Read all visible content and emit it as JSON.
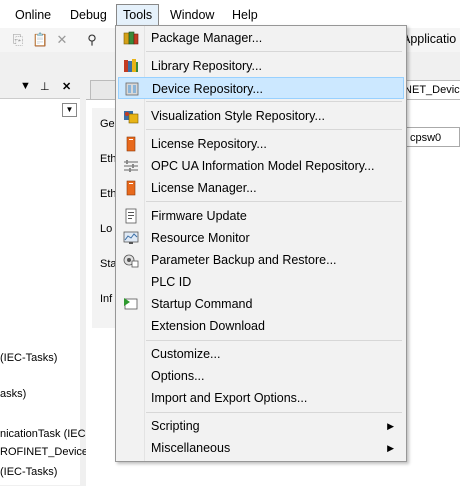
{
  "menubar": {
    "items": [
      {
        "label": "Online"
      },
      {
        "label": "Debug"
      },
      {
        "label": "Tools"
      },
      {
        "label": "Window"
      },
      {
        "label": "Help"
      }
    ]
  },
  "toolbar": {
    "right_text": "Applicatio"
  },
  "editor": {
    "tab2_label": "INET_Devic",
    "device_field_value": "cpsw0",
    "vertical_tabs": [
      "Ge",
      "Eth",
      "Eth",
      "Lo",
      "Sta",
      "Inf"
    ]
  },
  "left_panel": {
    "lines": [
      "(IEC-Tasks)",
      "asks)",
      "nicationTask (IEC",
      "ROFINET_Device",
      "(IEC-Tasks)"
    ]
  },
  "tools_menu": {
    "items": [
      {
        "label": "Package Manager...",
        "icon": "package-icon"
      },
      {
        "label": "Library Repository...",
        "icon": "library-icon"
      },
      {
        "label": "Device Repository...",
        "icon": "device-repository-icon",
        "highlighted": true
      },
      {
        "label": "Visualization Style Repository...",
        "icon": "visualization-icon"
      },
      {
        "label": "License Repository...",
        "icon": "license-icon"
      },
      {
        "label": "OPC UA Information Model Repository...",
        "icon": "opcua-icon"
      },
      {
        "label": "License Manager...",
        "icon": "license-manager-icon"
      },
      {
        "label": "Firmware Update",
        "icon": "firmware-icon"
      },
      {
        "label": "Resource Monitor",
        "icon": "monitor-icon"
      },
      {
        "label": "Parameter Backup and Restore...",
        "icon": "backup-icon"
      },
      {
        "label": "PLC ID",
        "icon": ""
      },
      {
        "label": "Startup Command",
        "icon": "startup-icon"
      },
      {
        "label": "Extension Download",
        "icon": ""
      },
      {
        "label": "Customize...",
        "icon": ""
      },
      {
        "label": "Options...",
        "icon": ""
      },
      {
        "label": "Import and Export Options...",
        "icon": ""
      },
      {
        "label": "Scripting",
        "icon": "",
        "submenu": true
      },
      {
        "label": "Miscellaneous",
        "icon": "",
        "submenu": true
      }
    ]
  }
}
